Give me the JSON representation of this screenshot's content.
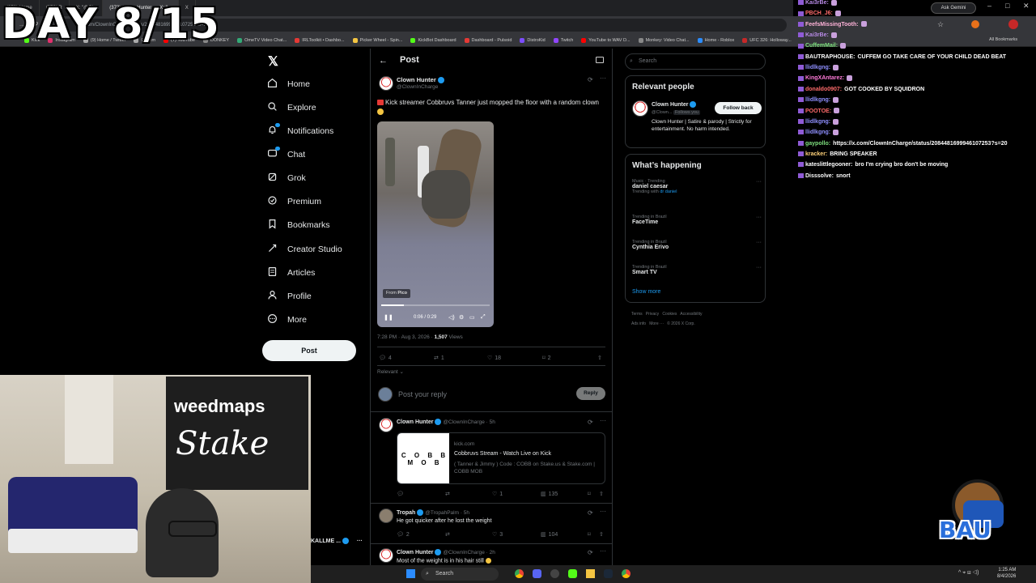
{
  "overlay": {
    "day": "DAY 8/15"
  },
  "browser": {
    "tabs": [
      "(372) Home",
      "(372) R",
      "X: \"@Clo",
      "(372) Clown Hunter on X: \"...",
      "X"
    ],
    "url": "x.com/ClownInCharge/status/2084481699946107253?s=20",
    "ask_gemini": "Ask Gemini",
    "all_bookmarks": "All Bookmarks",
    "bookmarks": [
      "Kick",
      "Instagram",
      "(9) Home / Twitter",
      "Cuffem",
      "(7) YouTube",
      "DONKEY",
      "OmeTV Video Chat...",
      "IRLToolkit • Dashbo...",
      "Picker Wheel - Spin...",
      "KickBot Dashboard",
      "Dashboard - Pulsoid",
      "DistroKid",
      "Twitch",
      "YouTube to WAV D...",
      "Monkey: Video Chat...",
      "Home - Roblox",
      "UFC 326: Holloway..."
    ]
  },
  "nav": {
    "items": [
      {
        "label": "Home",
        "icon": "home-icon"
      },
      {
        "label": "Explore",
        "icon": "search-icon"
      },
      {
        "label": "Notifications",
        "icon": "bell-icon"
      },
      {
        "label": "Chat",
        "icon": "chat-icon"
      },
      {
        "label": "Grok",
        "icon": "grok-icon"
      },
      {
        "label": "Premium",
        "icon": "premium-icon"
      },
      {
        "label": "Bookmarks",
        "icon": "bookmark-icon"
      },
      {
        "label": "Creator Studio",
        "icon": "creator-studio-icon"
      },
      {
        "label": "Articles",
        "icon": "article-icon"
      },
      {
        "label": "Profile",
        "icon": "profile-icon"
      },
      {
        "label": "More",
        "icon": "more-icon"
      }
    ],
    "post_button": "Post",
    "account_name": "KALLME ..."
  },
  "post": {
    "header": "Post",
    "author_name": "Clown Hunter",
    "author_handle": "@ClownInCharge",
    "text": "Kick streamer Cobbruvs Tanner just mopped the floor with a random clown",
    "video": {
      "from_label": "From",
      "source": "Pico",
      "time": "0:06 / 0:29",
      "progress": 0.21
    },
    "time": "7:28 PM · Aug 3, 2026 · ",
    "views_count": "1,507",
    "views_label": " Views",
    "replies": "4",
    "reposts": "1",
    "likes": "18",
    "bookmarks": "2",
    "sort": "Relevant",
    "reply_placeholder": "Post your reply",
    "reply_button": "Reply"
  },
  "replies": [
    {
      "name": "Clown Hunter",
      "handle": "@ClownInCharge · 5h",
      "card": {
        "domain": "kick.com",
        "title": "Cobbruvs Stream - Watch Live on Kick",
        "desc": "( Tanner & Jimmy ) Code : COBB on Stake.us & Stake.com | COBB MOB",
        "logo": "C O B B M O B"
      },
      "likes": "1",
      "views": "135"
    },
    {
      "name": "Tropah",
      "handle": "@TropahPalm · 5h",
      "text": "He got quicker after he lost the weight",
      "replies": "2",
      "likes": "3",
      "views": "104"
    },
    {
      "name": "Clown Hunter",
      "handle": "@ClownInCharge · 2h",
      "text": "Most of the weight is in his hair still"
    }
  ],
  "right": {
    "search_placeholder": "Search",
    "relevant_title": "Relevant people",
    "person": {
      "name": "Clown Hunter",
      "handle": "@Clown...",
      "follows_you": "Follows you",
      "bio": "Clown Hunter | Satire & parody | Strictly for entertainment. No harm intended.",
      "follow_back": "Follow back"
    },
    "happening_title": "What’s happening",
    "trends": [
      {
        "meta": "Music · Trending",
        "name": "daniel caesar",
        "extra_prefix": "Trending with ",
        "extra_link": "dr daniel"
      },
      {
        "meta": "Trending in Brazil",
        "name": "FaceTime"
      },
      {
        "meta": "Trending in Brazil",
        "name": "Cynthia Erivo"
      },
      {
        "meta": "Trending in Brazil",
        "name": "Smart TV"
      }
    ],
    "show_more": "Show more",
    "footer_line1": "Terms   Privacy   Cookies   Accessibility",
    "footer_line2": "Ads info   More ···   © 2026 X Corp."
  },
  "chat": [
    {
      "user": "Kai3rBe:",
      "msg": "",
      "color": "#b98be8"
    },
    {
      "user": "PBCH_J6:",
      "msg": "",
      "color": "#ff6b6b"
    },
    {
      "user": "FeefsMissingTooth:",
      "msg": "",
      "color": "#ffb3d9"
    },
    {
      "user": "Kai3rBe:",
      "msg": "",
      "color": "#b98be8"
    },
    {
      "user": "CuffemMail:",
      "msg": "",
      "color": "#7ee07e"
    },
    {
      "user": "BAUTRAPHOUSE:",
      "msg": "CUFFEM GO TAKE CARE OF YOUR CHILD DEAD BEAT",
      "color": "#ffffff"
    },
    {
      "user": "llidlkgng:",
      "msg": "",
      "color": "#8f8fff"
    },
    {
      "user": "KingXAntarez:",
      "msg": "",
      "color": "#ff7ad9"
    },
    {
      "user": "donaldo0907:",
      "msg": "GOT COOKED BY SQUIDRON",
      "color": "#ff6b6b"
    },
    {
      "user": "llidlkgng:",
      "msg": "",
      "color": "#8f8fff"
    },
    {
      "user": "POOTOE:",
      "msg": "",
      "color": "#ff6b6b"
    },
    {
      "user": "llidlkgng:",
      "msg": "",
      "color": "#8f8fff"
    },
    {
      "user": "llidlkgng:",
      "msg": "",
      "color": "#8f8fff"
    },
    {
      "user": "gaypollo:",
      "msg": "https://x.com/ClownInCharge/status/2084481699946107253?s=20",
      "color": "#7ee07e"
    },
    {
      "user": "kracker:",
      "msg": "BRING SPEAKER",
      "color": "#ffd27a"
    },
    {
      "user": "kateslittlegooner:",
      "msg": "bro I'm crying bro don't be moving",
      "color": "#ffffff"
    },
    {
      "user": "Disssolve:",
      "msg": "snort",
      "color": "#ffffff"
    }
  ],
  "webcam": {
    "brand1": "weedmaps",
    "brand2": "Stake"
  },
  "logo": {
    "text": "BAU"
  },
  "taskbar": {
    "search": "Search",
    "time": "1:25 AM",
    "date": "8/4/2026"
  },
  "colors": {
    "accent": "#1d9bf0",
    "bg": "#000000",
    "border": "#2f3336",
    "muted": "#71767b"
  }
}
